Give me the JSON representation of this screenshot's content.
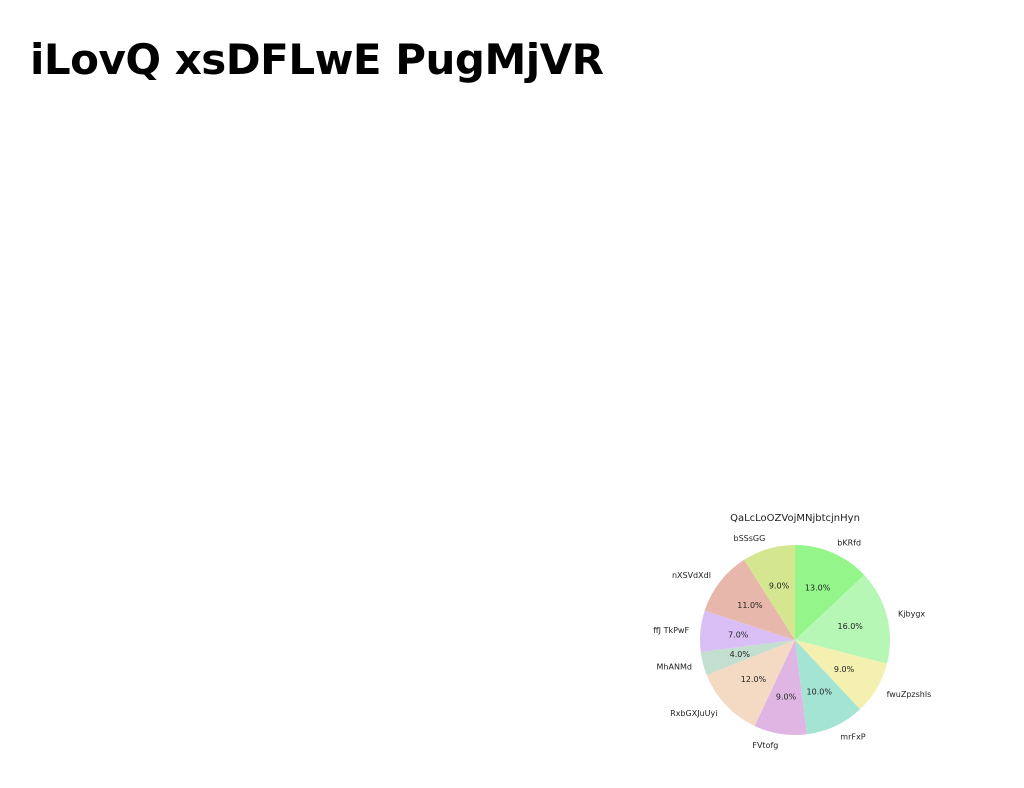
{
  "page": {
    "title": "iLovQ xsDFLwE PugMjVR"
  },
  "chart_data": {
    "type": "pie",
    "title": "QaLcLoOZVojMNjbtcjnHyn",
    "start_angle_deg": 90,
    "direction": "clockwise",
    "legend": "none",
    "slices": [
      {
        "label": "bKRfd",
        "value": 13.0,
        "display": "13.0%",
        "color": "#93f58a"
      },
      {
        "label": "Kjbygx",
        "value": 16.0,
        "display": "16.0%",
        "color": "#b7f7b6"
      },
      {
        "label": "fwuZpzshls",
        "value": 9.0,
        "display": "9.0%",
        "color": "#f4f0b0"
      },
      {
        "label": "mrFxP",
        "value": 10.0,
        "display": "10.0%",
        "color": "#a4e4d3"
      },
      {
        "label": "FVtofg",
        "value": 9.0,
        "display": "9.0%",
        "color": "#dfb6e3"
      },
      {
        "label": "RxbGXJuUyi",
        "value": 12.0,
        "display": "12.0%",
        "color": "#f4dac2"
      },
      {
        "label": "MhANMd",
        "value": 4.0,
        "display": "4.0%",
        "color": "#c3dfcf"
      },
      {
        "label": "ffJ TkPwF",
        "value": 7.0,
        "display": "7.0%",
        "color": "#d9bff6"
      },
      {
        "label": "nXSVdXdl",
        "value": 11.0,
        "display": "11.0%",
        "color": "#e8b7ab"
      },
      {
        "label": "bSSsGG",
        "value": 9.0,
        "display": "9.0%",
        "color": "#d5e690"
      }
    ]
  }
}
